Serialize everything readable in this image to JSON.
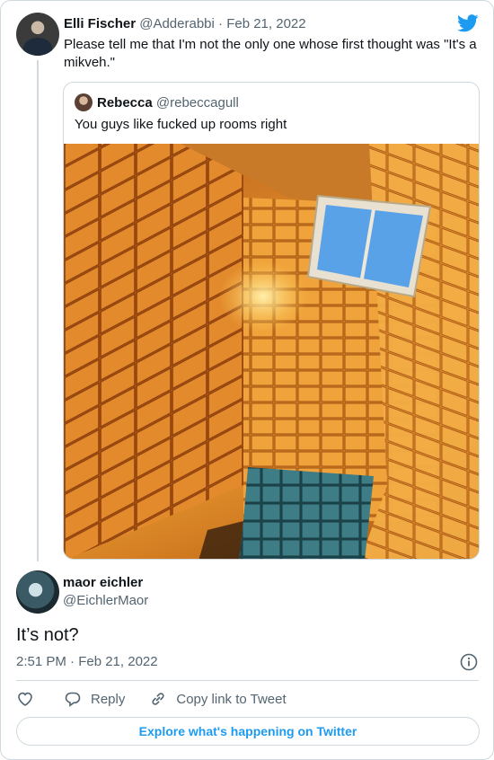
{
  "parent_tweet": {
    "author_name": "Elli Fischer",
    "author_handle": "@Adderabbi",
    "separator": "·",
    "date": "Feb 21, 2022",
    "text": "Please tell me that I'm not the only one whose first thought was \"It's a mikveh.\""
  },
  "quoted_tweet": {
    "author_name": "Rebecca",
    "author_handle": "@rebeccagull",
    "text": "You guys like fucked up rooms right",
    "photo_icon": "photo-tiled-room"
  },
  "reply_tweet": {
    "author_name": "maor eichler",
    "author_handle": "@EichlerMaor",
    "text": "It’s not?",
    "timestamp": "2:51 PM · Feb 21, 2022"
  },
  "actions": {
    "like_icon": "heart-icon",
    "reply_label": "Reply",
    "copy_label": "Copy link to Tweet"
  },
  "footer": {
    "explore_label": "Explore what's happening on Twitter"
  },
  "colors": {
    "twitter_blue": "#1d9bf0",
    "muted_text": "#536471",
    "border": "#cfd9de"
  }
}
